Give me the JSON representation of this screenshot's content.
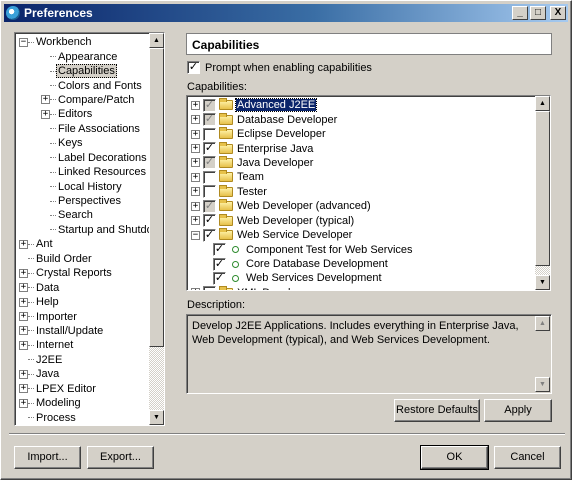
{
  "window": {
    "title": "Preferences",
    "minimize": "_",
    "maximize": "□",
    "close": "X"
  },
  "tree": {
    "items": [
      {
        "label": "Workbench",
        "expander": "−",
        "level": 0
      },
      {
        "label": "Appearance",
        "level": 1
      },
      {
        "label": "Capabilities",
        "level": 1,
        "selected": true
      },
      {
        "label": "Colors and Fonts",
        "level": 1
      },
      {
        "label": "Compare/Patch",
        "level": 1,
        "expander": "+"
      },
      {
        "label": "Editors",
        "level": 1,
        "expander": "+"
      },
      {
        "label": "File Associations",
        "level": 1
      },
      {
        "label": "Keys",
        "level": 1
      },
      {
        "label": "Label Decorations",
        "level": 1
      },
      {
        "label": "Linked Resources",
        "level": 1
      },
      {
        "label": "Local History",
        "level": 1
      },
      {
        "label": "Perspectives",
        "level": 1
      },
      {
        "label": "Search",
        "level": 1
      },
      {
        "label": "Startup and Shutdown",
        "level": 1
      },
      {
        "label": "Ant",
        "level": 0,
        "expander": "+"
      },
      {
        "label": "Build Order",
        "level": 0
      },
      {
        "label": "Crystal Reports",
        "level": 0,
        "expander": "+"
      },
      {
        "label": "Data",
        "level": 0,
        "expander": "+"
      },
      {
        "label": "Help",
        "level": 0,
        "expander": "+"
      },
      {
        "label": "Importer",
        "level": 0,
        "expander": "+"
      },
      {
        "label": "Install/Update",
        "level": 0,
        "expander": "+"
      },
      {
        "label": "Internet",
        "level": 0,
        "expander": "+"
      },
      {
        "label": "J2EE",
        "level": 0
      },
      {
        "label": "Java",
        "level": 0,
        "expander": "+"
      },
      {
        "label": "LPEX Editor",
        "level": 0,
        "expander": "+"
      },
      {
        "label": "Modeling",
        "level": 0,
        "expander": "+"
      },
      {
        "label": "Process",
        "level": 0
      }
    ]
  },
  "page": {
    "title": "Capabilities",
    "prompt_label": "Prompt when enabling capabilities",
    "prompt_checked": "✓",
    "capabilities_label": "Capabilities:",
    "description_label": "Description:",
    "description_text": "Develop J2EE Applications.  Includes everything in Enterprise Java, Web Development (typical), and Web Services Development."
  },
  "capabilities": [
    {
      "label": "Advanced J2EE",
      "expander": "+",
      "check": "✓",
      "state": "gray",
      "selected": true
    },
    {
      "label": "Database Developer",
      "expander": "+",
      "check": "✓",
      "state": "gray"
    },
    {
      "label": "Eclipse Developer",
      "expander": "+",
      "check": "",
      "state": "empty"
    },
    {
      "label": "Enterprise Java",
      "expander": "+",
      "check": "✓",
      "state": "checked"
    },
    {
      "label": "Java Developer",
      "expander": "+",
      "check": "✓",
      "state": "gray"
    },
    {
      "label": "Team",
      "expander": "+",
      "check": "",
      "state": "empty"
    },
    {
      "label": "Tester",
      "expander": "+",
      "check": "",
      "state": "empty"
    },
    {
      "label": "Web Developer (advanced)",
      "expander": "+",
      "check": "✓",
      "state": "gray"
    },
    {
      "label": "Web Developer (typical)",
      "expander": "+",
      "check": "✓",
      "state": "checked"
    },
    {
      "label": "Web Service Developer",
      "expander": "−",
      "check": "✓",
      "state": "checked"
    },
    {
      "label": "Component Test for Web Services",
      "child": true,
      "check": "✓",
      "state": "checked"
    },
    {
      "label": "Core Database Development",
      "child": true,
      "check": "✓",
      "state": "checked"
    },
    {
      "label": "Web Services Development",
      "child": true,
      "check": "✓",
      "state": "checked"
    },
    {
      "label": "XML Developer",
      "expander": "+",
      "check": "",
      "state": "empty"
    }
  ],
  "buttons": {
    "restore_defaults": "Restore Defaults",
    "apply": "Apply",
    "import": "Import...",
    "export": "Export...",
    "ok": "OK",
    "cancel": "Cancel"
  },
  "scroll_glyphs": {
    "up": "▲",
    "down": "▼"
  }
}
